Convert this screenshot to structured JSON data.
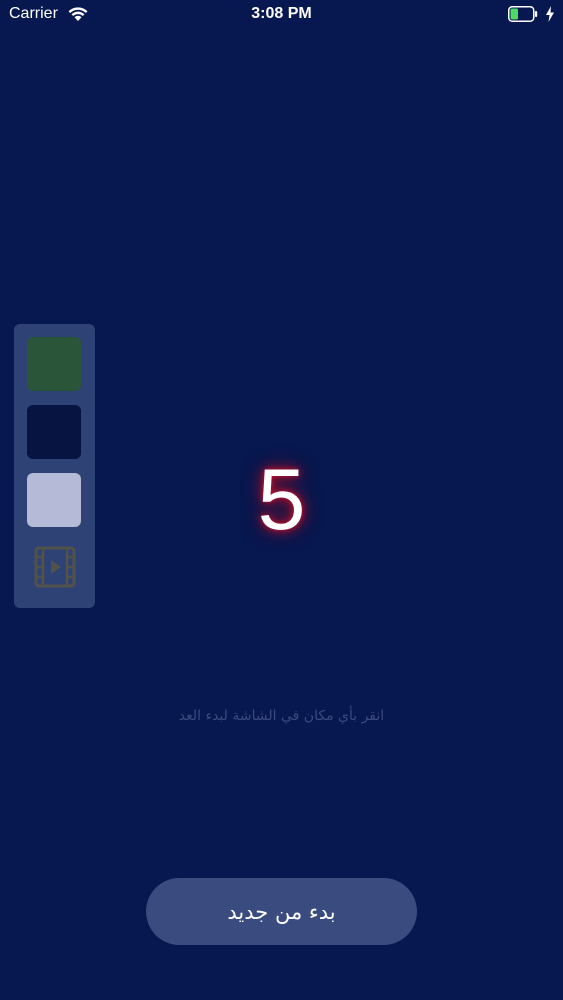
{
  "status_bar": {
    "carrier": "Carrier",
    "time": "3:08 PM",
    "icons": [
      "wifi-icon",
      "battery-icon",
      "charging-icon"
    ],
    "battery_level": 0.3
  },
  "color_panel": {
    "swatches": [
      {
        "name": "green",
        "color": "#2e5c37"
      },
      {
        "name": "navy",
        "color": "#081440"
      },
      {
        "name": "light",
        "color": "#c8cde6"
      }
    ],
    "video_icon": "film-play-icon"
  },
  "countdown": {
    "value": "5",
    "glow_color": "#c8102e"
  },
  "hint_text": "انقر بأي مكان في الشاشة لبدء العد",
  "restart_button": {
    "label": "بدء من جديد"
  },
  "colors": {
    "background": "#07174f",
    "panel": "#34477a",
    "button": "#3a4b7f"
  }
}
